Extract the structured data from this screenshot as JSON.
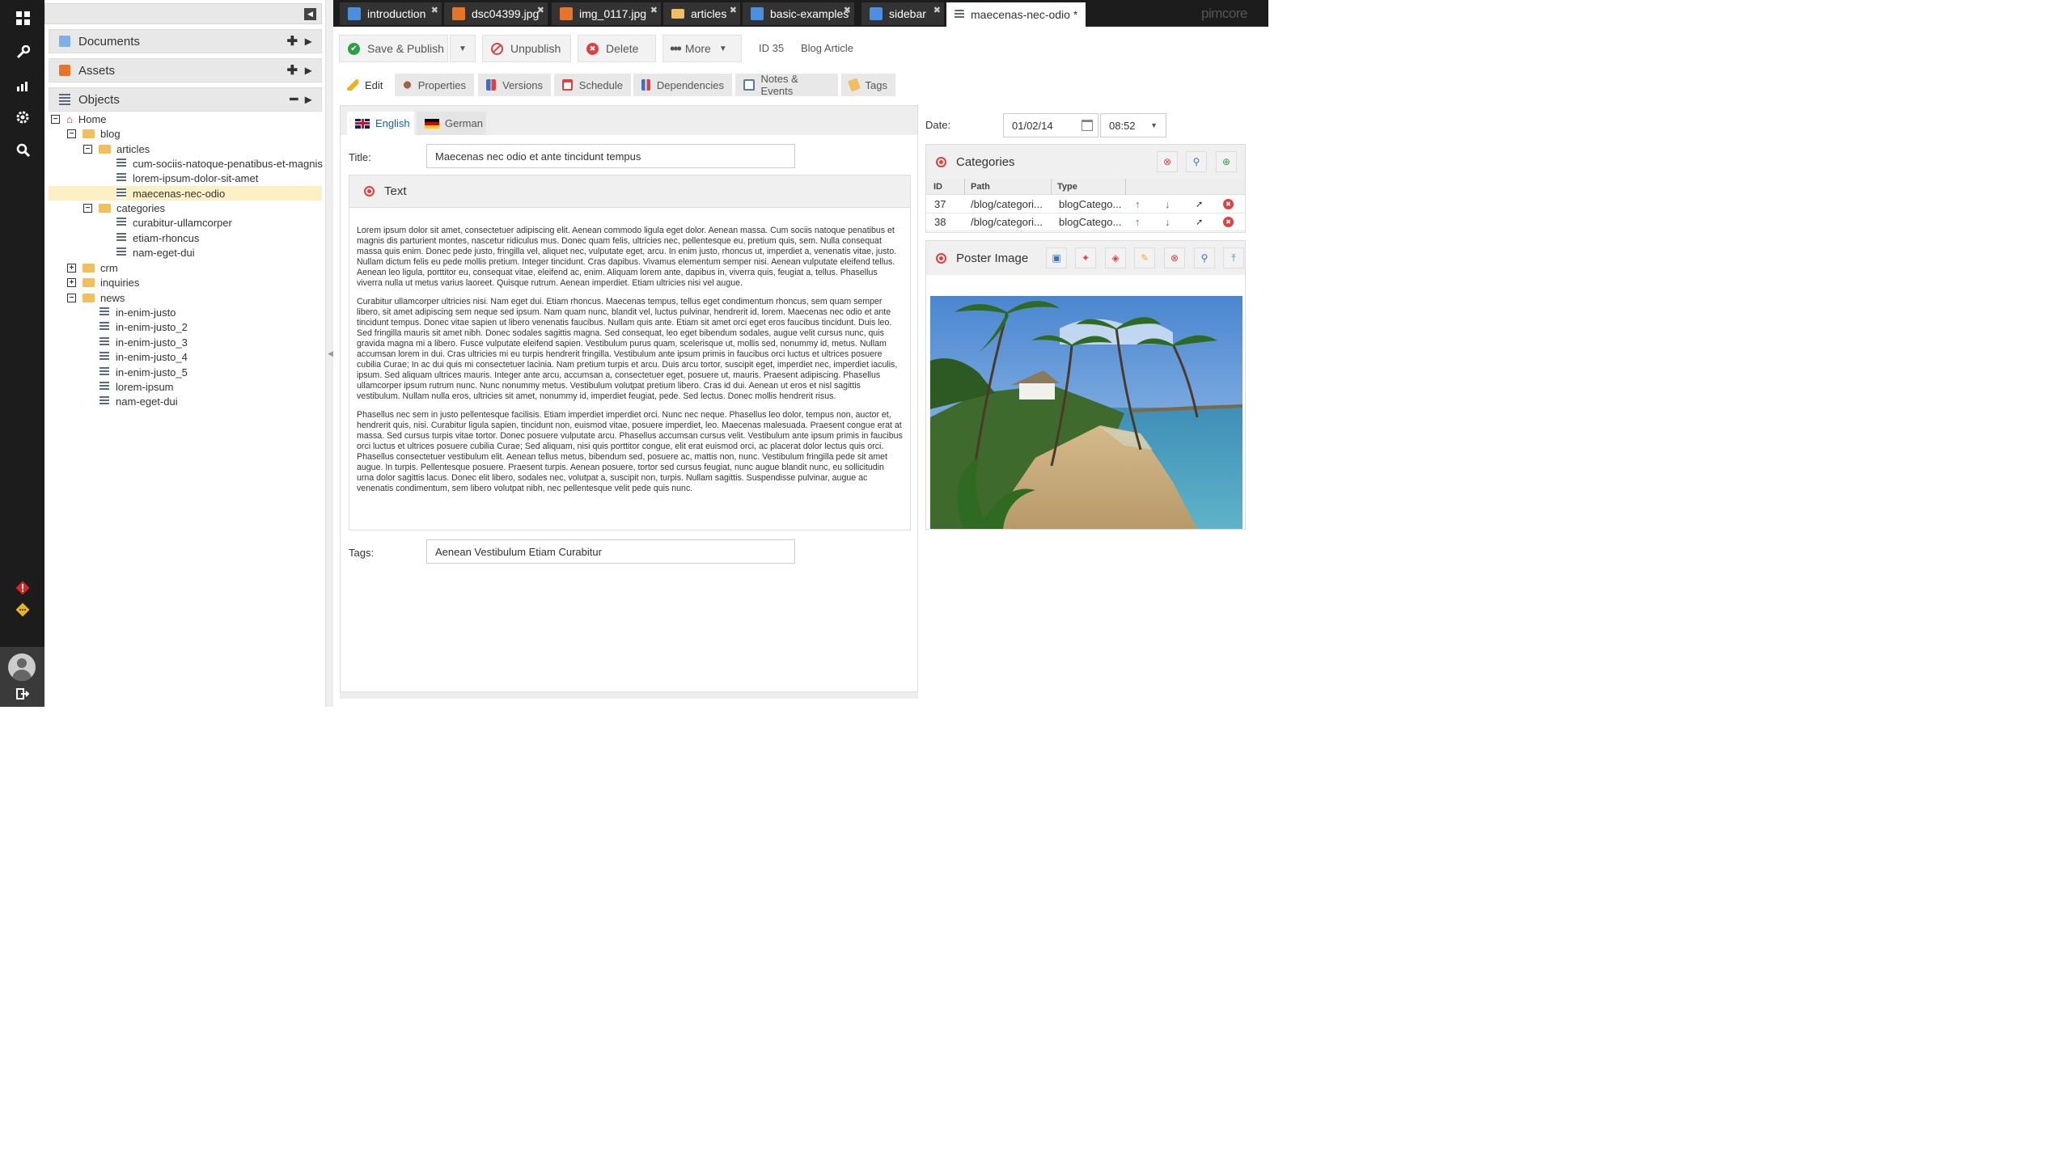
{
  "app": {
    "brand": "pimcore"
  },
  "leftbar": {
    "icons": [
      "grid-icon",
      "wrench-icon",
      "chart-icon",
      "gear-icon",
      "search-icon",
      "alert-icon",
      "warning-icon",
      "avatar",
      "logout-icon"
    ]
  },
  "tree": {
    "documents_label": "Documents",
    "assets_label": "Assets",
    "objects_label": "Objects",
    "nodes": [
      {
        "label": "Home"
      },
      {
        "label": "blog"
      },
      {
        "label": "articles"
      },
      {
        "label": "cum-sociis-natoque-penatibus-et-magnis"
      },
      {
        "label": "lorem-ipsum-dolor-sit-amet"
      },
      {
        "label": "maecenas-nec-odio"
      },
      {
        "label": "categories"
      },
      {
        "label": "curabitur-ullamcorper"
      },
      {
        "label": "etiam-rhoncus"
      },
      {
        "label": "nam-eget-dui"
      },
      {
        "label": "crm"
      },
      {
        "label": "inquiries"
      },
      {
        "label": "news"
      },
      {
        "label": "in-enim-justo"
      },
      {
        "label": "in-enim-justo_2"
      },
      {
        "label": "in-enim-justo_3"
      },
      {
        "label": "in-enim-justo_4"
      },
      {
        "label": "in-enim-justo_5"
      },
      {
        "label": "lorem-ipsum"
      },
      {
        "label": "nam-eget-dui"
      }
    ]
  },
  "tabs": [
    {
      "label": "introduction"
    },
    {
      "label": "dsc04399.jpg"
    },
    {
      "label": "img_0117.jpg"
    },
    {
      "label": "articles"
    },
    {
      "label": "basic-examples"
    },
    {
      "label": "sidebar"
    },
    {
      "label": "maecenas-nec-odio *"
    }
  ],
  "toolbar": {
    "save_publish": "Save & Publish",
    "unpublish": "Unpublish",
    "delete": "Delete",
    "more": "More",
    "id": "ID 35",
    "class": "Blog Article"
  },
  "subtabs": [
    "Edit",
    "Properties",
    "Versions",
    "Schedule",
    "Dependencies",
    "Notes & Events",
    "Tags"
  ],
  "langs": [
    "English",
    "German"
  ],
  "form": {
    "title_label": "Title:",
    "title_value": "Maecenas nec odio et ante tincidunt tempus",
    "text_label": "Text",
    "paragraphs": [
      "Lorem ipsum dolor sit amet, consectetuer adipiscing elit. Aenean commodo ligula eget dolor. Aenean massa. Cum sociis natoque penatibus et magnis dis parturient montes, nascetur ridiculus mus. Donec quam felis, ultricies nec, pellentesque eu, pretium quis, sem. Nulla consequat massa quis enim. Donec pede justo, fringilla vel, aliquet nec, vulputate eget, arcu. In enim justo, rhoncus ut, imperdiet a, venenatis vitae, justo. Nullam dictum felis eu pede mollis pretium. Integer tincidunt. Cras dapibus. Vivamus elementum semper nisi. Aenean vulputate eleifend tellus. Aenean leo ligula, porttitor eu, consequat vitae, eleifend ac, enim. Aliquam lorem ante, dapibus in, viverra quis, feugiat a, tellus. Phasellus viverra nulla ut metus varius laoreet. Quisque rutrum. Aenean imperdiet. Etiam ultricies nisi vel augue.",
      "Curabitur ullamcorper ultricies nisi. Nam eget dui. Etiam rhoncus. Maecenas tempus, tellus eget condimentum rhoncus, sem quam semper libero, sit amet adipiscing sem neque sed ipsum. Nam quam nunc, blandit vel, luctus pulvinar, hendrerit id, lorem. Maecenas nec odio et ante tincidunt tempus. Donec vitae sapien ut libero venenatis faucibus. Nullam quis ante. Etiam sit amet orci eget eros faucibus tincidunt. Duis leo. Sed fringilla mauris sit amet nibh. Donec sodales sagittis magna. Sed consequat, leo eget bibendum sodales, augue velit cursus nunc, quis gravida magna mi a libero. Fusce vulputate eleifend sapien. Vestibulum purus quam, scelerisque ut, mollis sed, nonummy id, metus. Nullam accumsan lorem in dui. Cras ultricies mi eu turpis hendrerit fringilla. Vestibulum ante ipsum primis in faucibus orci luctus et ultrices posuere cubilia Curae; In ac dui quis mi consectetuer lacinia. Nam pretium turpis et arcu. Duis arcu tortor, suscipit eget, imperdiet nec, imperdiet iaculis, ipsum. Sed aliquam ultrices mauris. Integer ante arcu, accumsan a, consectetuer eget, posuere ut, mauris. Praesent adipiscing. Phasellus ullamcorper ipsum rutrum nunc. Nunc nonummy metus. Vestibulum volutpat pretium libero. Cras id dui. Aenean ut eros et nisl sagittis vestibulum. Nullam nulla eros, ultricies sit amet, nonummy id, imperdiet feugiat, pede. Sed lectus. Donec mollis hendrerit risus.",
      "Phasellus nec sem in justo pellentesque facilisis. Etiam imperdiet imperdiet orci. Nunc nec neque. Phasellus leo dolor, tempus non, auctor et, hendrerit quis, nisi. Curabitur ligula sapien, tincidunt non, euismod vitae, posuere imperdiet, leo. Maecenas malesuada. Praesent congue erat at massa. Sed cursus turpis vitae tortor. Donec posuere vulputate arcu. Phasellus accumsan cursus velit. Vestibulum ante ipsum primis in faucibus orci luctus et ultrices posuere cubilia Curae; Sed aliquam, nisi quis porttitor congue, elit erat euismod orci, ac placerat dolor lectus quis orci. Phasellus consectetuer vestibulum elit. Aenean tellus metus, bibendum sed, posuere ac, mattis non, nunc. Vestibulum fringilla pede sit amet augue. In turpis. Pellentesque posuere. Praesent turpis. Aenean posuere, tortor sed cursus feugiat, nunc augue blandit nunc, eu sollicitudin urna dolor sagittis lacus. Donec elit libero, sodales nec, volutpat a, suscipit non, turpis. Nullam sagittis. Suspendisse pulvinar, augue ac venenatis condimentum, sem libero volutpat nibh, nec pellentesque velit pede quis nunc."
    ],
    "tags_label": "Tags:",
    "tags_value": "Aenean Vestibulum Etiam Curabitur",
    "date_label": "Date:",
    "date_value": "01/02/14",
    "time_value": "08:52"
  },
  "categories": {
    "title": "Categories",
    "headers": [
      "ID",
      "Path",
      "Type"
    ],
    "rows": [
      {
        "id": "37",
        "path": "/blog/categori...",
        "type": "blogCatego..."
      },
      {
        "id": "38",
        "path": "/blog/categori...",
        "type": "blogCatego..."
      }
    ]
  },
  "poster": {
    "title": "Poster Image"
  },
  "colors": {
    "accent": "#e8b41f",
    "dark": "#1c1c1c",
    "selected": "#fdf0c4",
    "danger": "#e04040",
    "success": "#2e9e4a"
  }
}
